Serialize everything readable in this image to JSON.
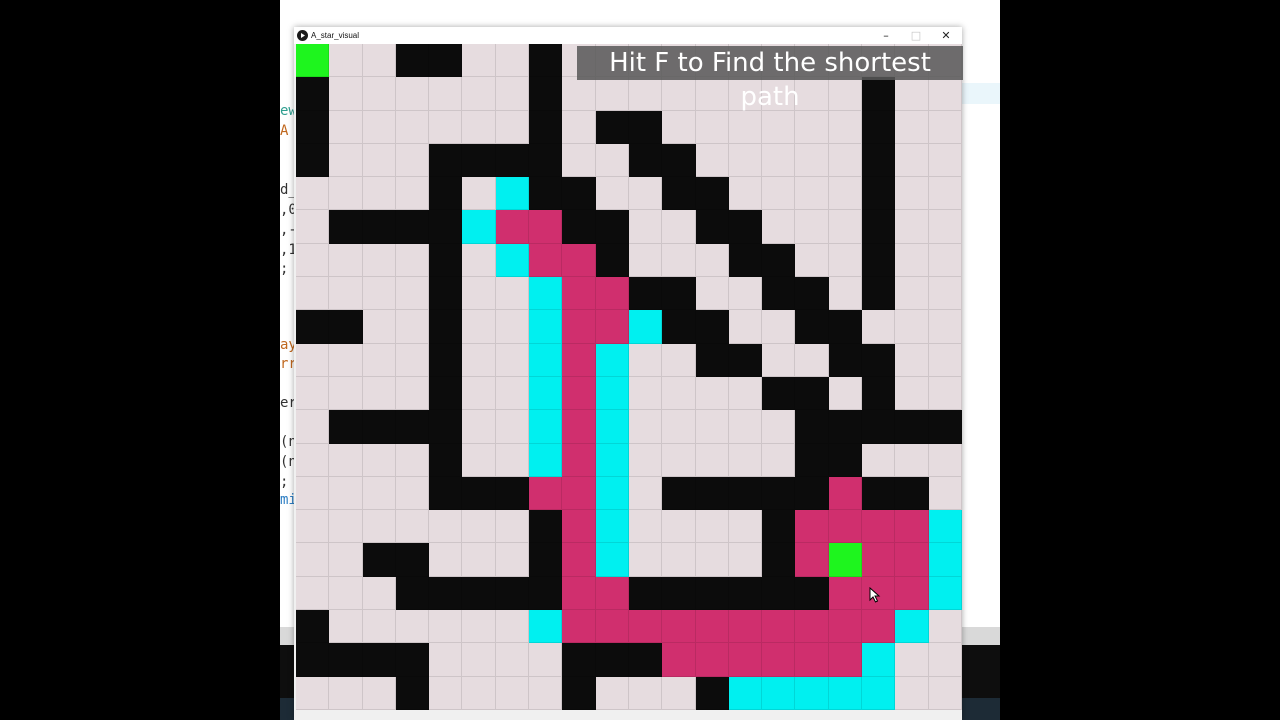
{
  "window": {
    "title": "A_star_visual",
    "minimize_glyph": "–",
    "maximize_glyph": "□",
    "close_glyph": "✕",
    "app_icon": "play-circle-icon"
  },
  "overlay": {
    "hint": "Hit F to Find the shortest path"
  },
  "cursor": {
    "icon": "mouse-pointer-icon"
  },
  "editor": {
    "lines": [
      {
        "text": "ew",
        "color": "#2e9e8f"
      },
      {
        "text": "A",
        "color": "#c0681f"
      },
      {
        "text": "d_",
        "color": "#333333"
      },
      {
        "text": ",0",
        "color": "#333333"
      },
      {
        "text": ",-",
        "color": "#333333"
      },
      {
        "text": ",1",
        "color": "#333333"
      },
      {
        "text": ";",
        "color": "#333333"
      },
      {
        "text": "ay",
        "color": "#c0681f"
      },
      {
        "text": "rr",
        "color": "#c0681f"
      },
      {
        "text": "er",
        "color": "#333333"
      },
      {
        "text": "(n",
        "color": "#333333"
      },
      {
        "text": "(n",
        "color": "#333333"
      },
      {
        "text": ";",
        "color": "#333333"
      },
      {
        "text": "mi",
        "color": "#2e7fc4"
      }
    ]
  },
  "legend": {
    "0": {
      "state": "open",
      "color": "#e6dcdf"
    },
    "1": {
      "state": "wall",
      "color": "#0c0c0c"
    },
    "2": {
      "state": "start/end",
      "color": "#1ef51e"
    },
    "3": {
      "state": "frontier",
      "color": "#00f0f0"
    },
    "4": {
      "state": "visited",
      "color": "#d02f6e"
    }
  },
  "maze": {
    "rows": 20,
    "cols": 20,
    "cells": [
      "20011001000000000000",
      "10000001000000000100",
      "10000001011000000100",
      "10001111001100000100",
      "00001031100110000100",
      "01111344110011000100",
      "00001034410001100100",
      "00001003441100110100",
      "11001003443110011000",
      "00001003430011001100",
      "00001003430000110100",
      "01111003430000011111",
      "00001003430000011000",
      "00001114430111114110",
      "00000001430000144443",
      "00110001430000142443",
      "00011111441111114443",
      "10000003444444444430",
      "11110000111444444300",
      "00010000100013333300"
    ]
  }
}
